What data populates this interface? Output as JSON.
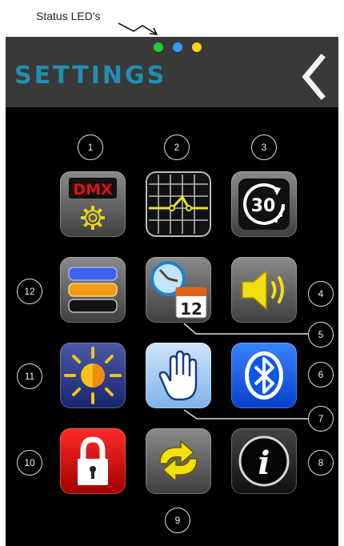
{
  "annotation": {
    "caption": "Status LED's"
  },
  "header": {
    "title": "SETTINGS",
    "back_icon": "chevron-left-icon",
    "leds": [
      {
        "name": "green",
        "color": "#22cc33"
      },
      {
        "name": "blue",
        "color": "#3399ff"
      },
      {
        "name": "yellow",
        "color": "#ffd21a"
      }
    ]
  },
  "colors": {
    "title": "#1f8fb0",
    "background": "#000000",
    "header_bar": "#393939"
  },
  "tiles": {
    "dmx": {
      "icon": "dmx-gear-icon",
      "text": "DMX",
      "number": "1"
    },
    "curve": {
      "icon": "dimmer-curve-grid-icon",
      "number": "2"
    },
    "timer": {
      "icon": "timer-30-icon",
      "text": "30",
      "number": "3"
    },
    "sound": {
      "icon": "speaker-icon",
      "number": "4"
    },
    "calendar": {
      "icon": "clock-calendar-icon",
      "text": "12",
      "number": "5"
    },
    "bluetooth": {
      "icon": "bluetooth-icon",
      "number": "6"
    },
    "hand": {
      "icon": "hand-icon",
      "number": "7"
    },
    "info": {
      "icon": "info-icon",
      "text": "i",
      "number": "8"
    },
    "sync": {
      "icon": "sync-arrows-icon",
      "number": "9"
    },
    "lock": {
      "icon": "lock-icon",
      "number": "10"
    },
    "brightness": {
      "icon": "sun-brightness-icon",
      "number": "11"
    },
    "presets": {
      "icon": "color-bars-icon",
      "number": "12"
    }
  }
}
